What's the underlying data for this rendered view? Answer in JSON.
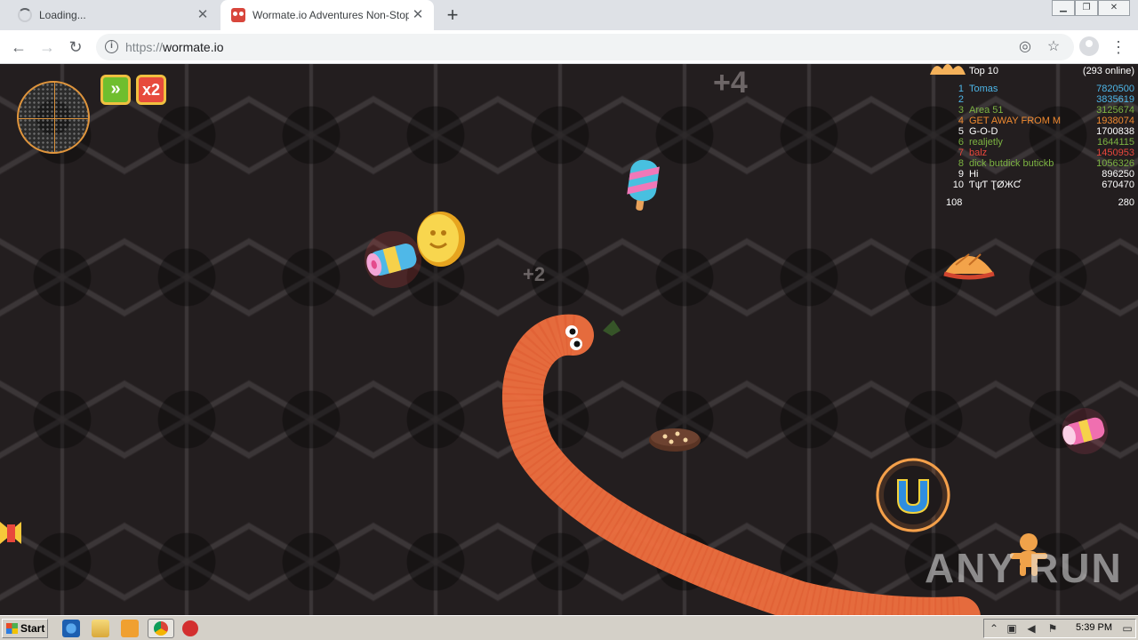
{
  "browser": {
    "tabs": [
      {
        "title": "Loading...",
        "state": "loading"
      },
      {
        "title": "Wormate.io Adventures Non-Stop",
        "state": "active"
      }
    ],
    "new_tab_icon": "plus-icon",
    "address": {
      "scheme": "https://",
      "host": "wormate.io"
    },
    "window_controls": [
      "minimize-icon",
      "restore-icon",
      "close-icon"
    ]
  },
  "game": {
    "powerups": [
      {
        "name": "speed",
        "label": "»"
      },
      {
        "name": "multiplier",
        "label": "x2"
      }
    ],
    "floating_texts": [
      "+4",
      "+2"
    ],
    "leaderboard": {
      "title": "Top 10",
      "online": "(293 online)",
      "rows": [
        {
          "rank": "1",
          "name": "Tomas",
          "score": "7820500",
          "color": "#4db6e8"
        },
        {
          "rank": "2",
          "name": "",
          "score": "3835619",
          "color": "#4db6e8"
        },
        {
          "rank": "3",
          "name": "Area 51",
          "score": "3125674",
          "color": "#7cb342"
        },
        {
          "rank": "4",
          "name": "GET AWAY FROM M",
          "score": "1938074",
          "color": "#f08a30"
        },
        {
          "rank": "5",
          "name": "G-O-D",
          "score": "1700838",
          "color": "#ffffff"
        },
        {
          "rank": "6",
          "name": "realjetly",
          "score": "1644115",
          "color": "#7cb342"
        },
        {
          "rank": "7",
          "name": "balz",
          "score": "1450953",
          "color": "#e8473c"
        },
        {
          "rank": "8",
          "name": "dick butdick butickb",
          "score": "1056326",
          "color": "#7cb342"
        },
        {
          "rank": "9",
          "name": "Hi",
          "score": "896250",
          "color": "#ffffff"
        },
        {
          "rank": "10",
          "name": "ƬψƬ ƮØЖƇ",
          "score": "670470",
          "color": "#ffffff"
        }
      ],
      "player_rank": "108",
      "player_score": "280"
    },
    "watermark": "ANY RUN"
  },
  "taskbar": {
    "start_label": "Start",
    "quick_launch": [
      "internet-explorer-icon",
      "folder-icon",
      "media-player-icon",
      "chrome-icon",
      "stop-icon"
    ],
    "tray_icons": [
      "chevron-up-icon",
      "network-icon",
      "volume-icon",
      "flag-icon",
      "monitor-icon"
    ],
    "clock": "5:39 PM"
  },
  "colors": {
    "worm": "#f0703f",
    "accent_orange": "#e0953c"
  }
}
